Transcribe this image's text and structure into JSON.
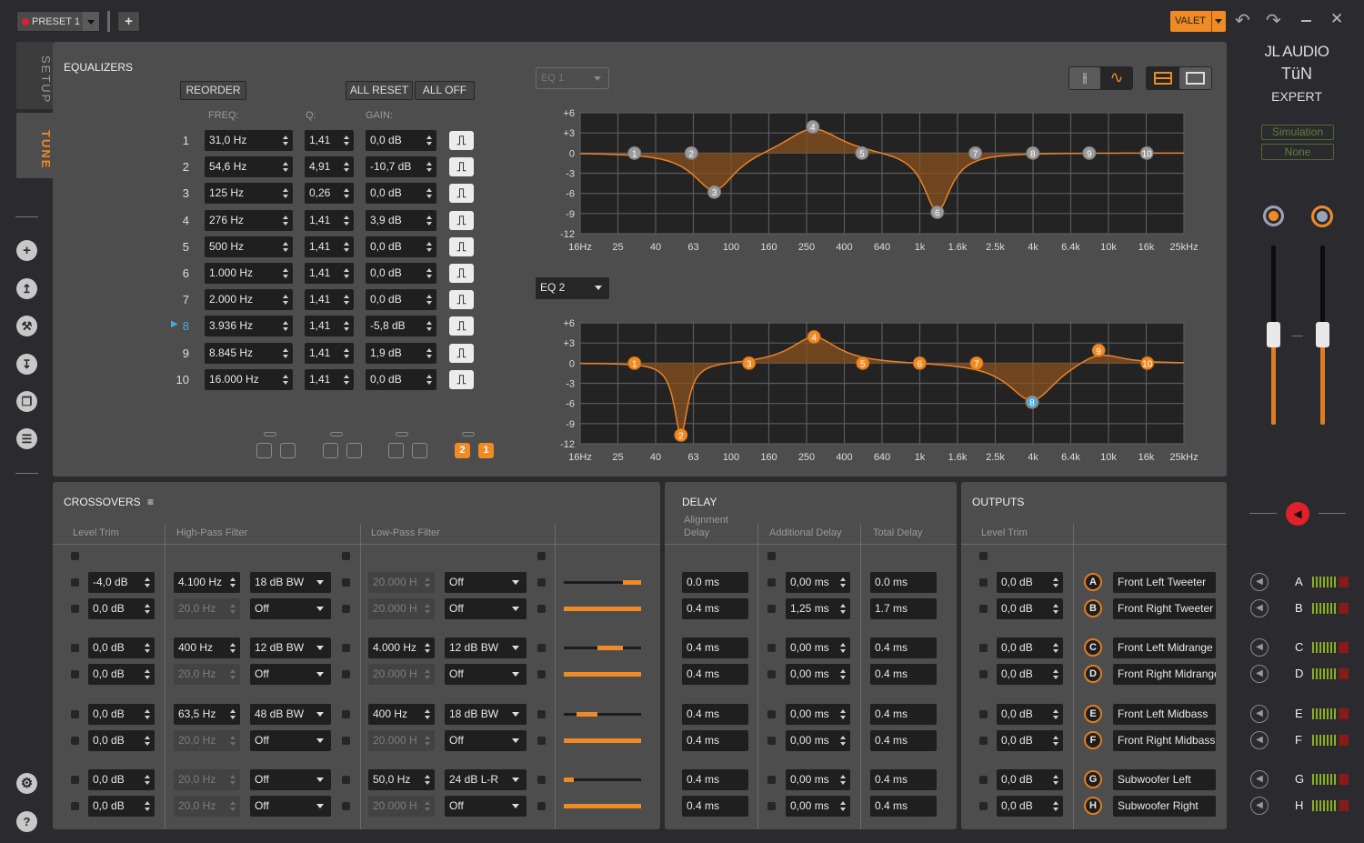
{
  "topbar": {
    "preset": "PRESET 1",
    "add": "+",
    "valet": "VALET"
  },
  "tabs": {
    "setup": "SETUP",
    "tune": "TUNE",
    "active": "TUNE"
  },
  "sidebar": {
    "icons": [
      "add-icon",
      "upload-icon",
      "wrench-icon",
      "download-icon",
      "copy-icon",
      "list-icon"
    ],
    "bottom_icons": [
      "gear-icon",
      "help-icon"
    ]
  },
  "colors": {
    "accent": "#f08a24",
    "selected": "#4aa8e0",
    "mute": "#e0202a"
  },
  "equalizers": {
    "title": "EQUALIZERS",
    "reorder": "REORDER",
    "all_reset": "ALL RESET",
    "all_off": "ALL OFF",
    "headers": {
      "freq": "FREQ:",
      "q": "Q:",
      "gain": "GAIN:"
    },
    "selected_band": "8",
    "bands": [
      {
        "num": "1",
        "freq": "31,0 Hz",
        "q": "1,41",
        "gain": "0,0 dB"
      },
      {
        "num": "2",
        "freq": "54,6 Hz",
        "q": "4,91",
        "gain": "-10,7 dB"
      },
      {
        "num": "3",
        "freq": "125 Hz",
        "q": "0,26",
        "gain": "0,0 dB"
      },
      {
        "num": "4",
        "freq": "276 Hz",
        "q": "1,41",
        "gain": "3,9 dB"
      },
      {
        "num": "5",
        "freq": "500 Hz",
        "q": "1,41",
        "gain": "0,0 dB"
      },
      {
        "num": "6",
        "freq": "1.000 Hz",
        "q": "1,41",
        "gain": "0,0 dB"
      },
      {
        "num": "7",
        "freq": "2.000 Hz",
        "q": "1,41",
        "gain": "0,0 dB"
      },
      {
        "num": "8",
        "freq": "3.936 Hz",
        "q": "1,41",
        "gain": "-5,8 dB"
      },
      {
        "num": "9",
        "freq": "8.845 Hz",
        "q": "1,41",
        "gain": "1,9 dB"
      },
      {
        "num": "10",
        "freq": "16.000 Hz",
        "q": "1,41",
        "gain": "0,0 dB"
      }
    ],
    "link_groups": [
      {
        "a": "",
        "b": "",
        "active": false
      },
      {
        "a": "",
        "b": "",
        "active": false
      },
      {
        "a": "",
        "b": "",
        "active": false
      },
      {
        "a": "2",
        "b": "1",
        "active": true
      }
    ]
  },
  "graphs": {
    "y_ticks": [
      "+6",
      "+3",
      "0",
      "-3",
      "-6",
      "-9",
      "-12"
    ],
    "x_ticks": [
      "16Hz",
      "25",
      "40",
      "63",
      "100",
      "160",
      "250",
      "400",
      "640",
      "1k",
      "1.6k",
      "2.5k",
      "4k",
      "6.4k",
      "10k",
      "16k",
      "25kHz"
    ],
    "ylim": [
      -12,
      6
    ],
    "xlim_hz": [
      16,
      25000
    ],
    "x_scale": "log",
    "list": [
      {
        "selector": "EQ 1",
        "active": false,
        "points": [
          {
            "band": "1",
            "freq": 31,
            "gain": 0
          },
          {
            "band": "2",
            "freq": 62,
            "gain": 0
          },
          {
            "band": "3",
            "freq": 82,
            "gain": -5.8
          },
          {
            "band": "4",
            "freq": 272,
            "gain": 3.9
          },
          {
            "band": "5",
            "freq": 495,
            "gain": 0
          },
          {
            "band": "6",
            "freq": 1240,
            "gain": -8.8
          },
          {
            "band": "7",
            "freq": 1970,
            "gain": 0
          },
          {
            "band": "8",
            "freq": 3970,
            "gain": 0
          },
          {
            "band": "9",
            "freq": 7890,
            "gain": 0
          },
          {
            "band": "10",
            "freq": 15900,
            "gain": 0
          }
        ]
      },
      {
        "selector": "EQ 2",
        "active": true,
        "points": [
          {
            "band": "1",
            "freq": 31,
            "gain": 0,
            "q": 1.41
          },
          {
            "band": "2",
            "freq": 54.6,
            "gain": -10.7,
            "q": 4.91
          },
          {
            "band": "3",
            "freq": 125,
            "gain": 0,
            "q": 0.26
          },
          {
            "band": "4",
            "freq": 276,
            "gain": 3.9,
            "q": 1.41
          },
          {
            "band": "5",
            "freq": 500,
            "gain": 0,
            "q": 1.41
          },
          {
            "band": "6",
            "freq": 1000,
            "gain": 0,
            "q": 1.41
          },
          {
            "band": "7",
            "freq": 2000,
            "gain": 0,
            "q": 1.41
          },
          {
            "band": "8",
            "freq": 3936,
            "gain": -5.8,
            "q": 1.41
          },
          {
            "band": "9",
            "freq": 8845,
            "gain": 1.9,
            "q": 1.41
          },
          {
            "band": "10",
            "freq": 16000,
            "gain": 0,
            "q": 1.41
          }
        ]
      }
    ],
    "view_modes": {
      "active": "curve-view",
      "layout": "split-view"
    }
  },
  "crossovers": {
    "title": "CROSSOVERS",
    "headers": {
      "level": "Level Trim",
      "hp": "High-Pass Filter",
      "lp": "Low-Pass Filter"
    },
    "rows": [
      {
        "level": "-4,0 dB",
        "hp_freq": "4.100 Hz",
        "hp_type": "18 dB BW",
        "hp_on": true,
        "lp_freq": "20.000 H",
        "lp_type": "Off",
        "lp_on": false,
        "band_hz": [
          4100,
          20000
        ]
      },
      {
        "level": "0,0 dB",
        "hp_freq": "20,0 Hz",
        "hp_type": "Off",
        "hp_on": false,
        "lp_freq": "20.000 H",
        "lp_type": "Off",
        "lp_on": false,
        "band_hz": [
          20,
          20000
        ]
      },
      {
        "level": "0,0 dB",
        "hp_freq": "400 Hz",
        "hp_type": "12 dB BW",
        "hp_on": true,
        "lp_freq": "4.000 Hz",
        "lp_type": "12 dB BW",
        "lp_on": true,
        "band_hz": [
          400,
          4000
        ]
      },
      {
        "level": "0,0 dB",
        "hp_freq": "20,0 Hz",
        "hp_type": "Off",
        "hp_on": false,
        "lp_freq": "20.000 H",
        "lp_type": "Off",
        "lp_on": false,
        "band_hz": [
          20,
          20000
        ]
      },
      {
        "level": "0,0 dB",
        "hp_freq": "63,5 Hz",
        "hp_type": "48 dB BW",
        "hp_on": true,
        "lp_freq": "400 Hz",
        "lp_type": "18 dB BW",
        "lp_on": true,
        "band_hz": [
          63.5,
          400
        ]
      },
      {
        "level": "0,0 dB",
        "hp_freq": "20,0 Hz",
        "hp_type": "Off",
        "hp_on": false,
        "lp_freq": "20.000 H",
        "lp_type": "Off",
        "lp_on": false,
        "band_hz": [
          20,
          20000
        ]
      },
      {
        "level": "0,0 dB",
        "hp_freq": "20,0 Hz",
        "hp_type": "Off",
        "hp_on": false,
        "lp_freq": "50,0 Hz",
        "lp_type": "24 dB L-R",
        "lp_on": true,
        "band_hz": [
          20,
          50
        ]
      },
      {
        "level": "0,0 dB",
        "hp_freq": "20,0 Hz",
        "hp_type": "Off",
        "hp_on": false,
        "lp_freq": "20.000 H",
        "lp_type": "Off",
        "lp_on": false,
        "band_hz": [
          20,
          20000
        ]
      }
    ]
  },
  "delay": {
    "title": "DELAY",
    "headers": {
      "alignment": "Alignment Delay",
      "additional": "Additional Delay",
      "total": "Total Delay"
    },
    "rows": [
      {
        "align": "0.0 ms",
        "add": "0,00 ms",
        "total": "0.0 ms"
      },
      {
        "align": "0.4 ms",
        "add": "1,25 ms",
        "total": "1.7 ms"
      },
      {
        "align": "0.4 ms",
        "add": "0,00 ms",
        "total": "0.4 ms"
      },
      {
        "align": "0.4 ms",
        "add": "0,00 ms",
        "total": "0.4 ms"
      },
      {
        "align": "0.4 ms",
        "add": "0,00 ms",
        "total": "0.4 ms"
      },
      {
        "align": "0.4 ms",
        "add": "0,00 ms",
        "total": "0.4 ms"
      },
      {
        "align": "0.4 ms",
        "add": "0,00 ms",
        "total": "0.4 ms"
      },
      {
        "align": "0.4 ms",
        "add": "0,00 ms",
        "total": "0.4 ms"
      }
    ]
  },
  "outputs": {
    "title": "OUTPUTS",
    "level_header": "Level Trim",
    "rows": [
      {
        "level": "0,0 dB",
        "letter": "A",
        "name": "Front Left Tweeter"
      },
      {
        "level": "0,0 dB",
        "letter": "B",
        "name": "Front Right Tweeter"
      },
      {
        "level": "0,0 dB",
        "letter": "C",
        "name": "Front Left Midrange"
      },
      {
        "level": "0,0 dB",
        "letter": "D",
        "name": "Front Right Midrange"
      },
      {
        "level": "0,0 dB",
        "letter": "E",
        "name": "Front Left Midbass"
      },
      {
        "level": "0,0 dB",
        "letter": "F",
        "name": "Front Right Midbass"
      },
      {
        "level": "0,0 dB",
        "letter": "G",
        "name": "Subwoofer Left"
      },
      {
        "level": "0,0 dB",
        "letter": "H",
        "name": "Subwoofer Right"
      }
    ]
  },
  "brand": {
    "line1": "JL AUDIO",
    "line2": "TüN",
    "line3": "EXPERT"
  },
  "simulation": {
    "label": "Simulation",
    "value": "None"
  },
  "master": {
    "muted": true
  }
}
